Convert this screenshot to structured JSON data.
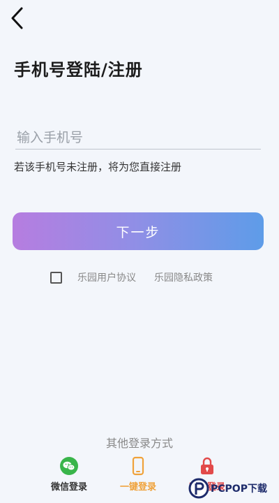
{
  "header": {
    "back_icon": "chevron-left-icon",
    "title": "手机号登陆/注册"
  },
  "form": {
    "phone_placeholder": "输入手机号",
    "phone_value": "",
    "hint": "若该手机号未注册，将为您直接注册",
    "next_label": "下一步"
  },
  "agreement": {
    "checked": false,
    "user_agreement": "乐园用户协议",
    "privacy_policy": "乐园隐私政策"
  },
  "other_login": {
    "title": "其他登录方式",
    "options": [
      {
        "label": "微信登录",
        "icon": "wechat-icon",
        "color": "#39b54a"
      },
      {
        "label": "一键登录",
        "icon": "phone-icon",
        "color": "#f0a23a"
      },
      {
        "label": "密码登录",
        "icon": "lock-icon",
        "color": "#e24a4a"
      }
    ]
  },
  "watermark": {
    "logo_text": "PCPOP下载"
  },
  "colors": {
    "background": "#f3f6fb",
    "button_gradient_start": "#b67de0",
    "button_gradient_end": "#5e9ce8"
  }
}
